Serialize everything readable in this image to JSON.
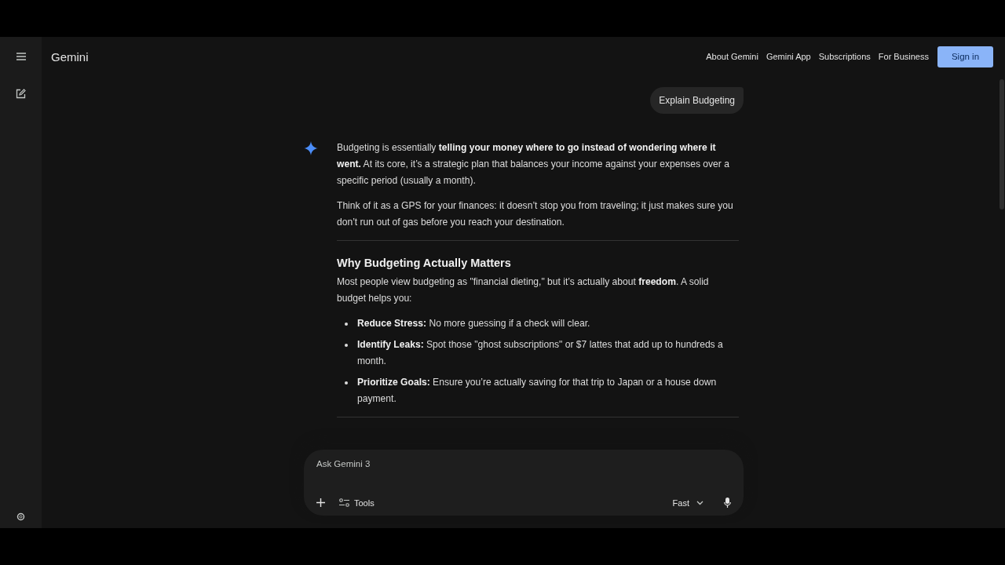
{
  "header": {
    "title": "Gemini",
    "nav": [
      "About Gemini",
      "Gemini App",
      "Subscriptions",
      "For Business"
    ],
    "sign_in": "Sign in"
  },
  "user_message": "Explain Budgeting",
  "response": [
    {
      "kind": "paragraph",
      "text": "Budgeting is essentially **telling your money where to go instead of wondering where it went.** At its core, it’s a strategic plan that balances your income against your expenses over a specific period (usually a month)."
    },
    {
      "kind": "paragraph",
      "text": "Think of it as a GPS for your finances: it doesn’t stop you from traveling; it just makes sure you don’t run out of gas before you reach your destination."
    },
    {
      "kind": "divider"
    },
    {
      "kind": "heading",
      "text": "Why Budgeting Actually Matters"
    },
    {
      "kind": "paragraph",
      "text": "Most people view budgeting as \"financial dieting,\" but it’s actually about **freedom**. A solid budget helps you:"
    },
    {
      "kind": "list",
      "items": [
        "**Reduce Stress:** No more guessing if a check will clear.",
        "**Identify Leaks:** Spot those \"ghost subscriptions\" or $7 lattes that add up to hundreds a month.",
        "**Prioritize Goals:** Ensure you’re actually saving for that trip to Japan or a house down payment."
      ]
    },
    {
      "kind": "divider"
    }
  ],
  "composer": {
    "placeholder": "Ask Gemini 3",
    "tools": "Tools",
    "model": "Fast"
  }
}
